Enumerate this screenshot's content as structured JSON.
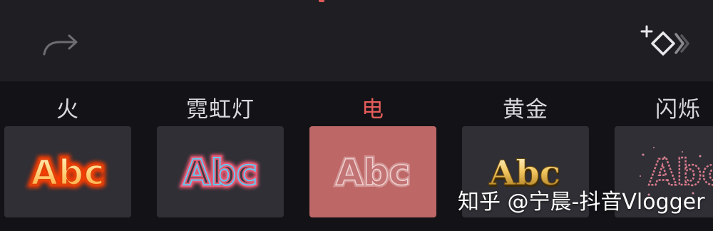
{
  "toolbar": {
    "redo_icon": "redo-arrow-icon",
    "keyframe_icon": "add-keyframe-icon"
  },
  "effects": [
    {
      "label": "火",
      "preview_text": "Abc",
      "style": "fire"
    },
    {
      "label": "霓虹灯",
      "preview_text": "Abc",
      "style": "neon"
    },
    {
      "label": "电",
      "preview_text": "Abc",
      "style": "electric",
      "selected": true
    },
    {
      "label": "黄金",
      "preview_text": "Abc",
      "style": "gold"
    },
    {
      "label": "闪烁",
      "preview_text": "Abc",
      "style": "sparkle"
    }
  ],
  "colors": {
    "accent": "#e45c5a",
    "selected_tile": "#bd6766",
    "tile": "#2f2f35",
    "topbar": "#1f1f23",
    "strip": "#131317"
  },
  "watermark": "知乎 @宁晨-抖音Vlogger"
}
